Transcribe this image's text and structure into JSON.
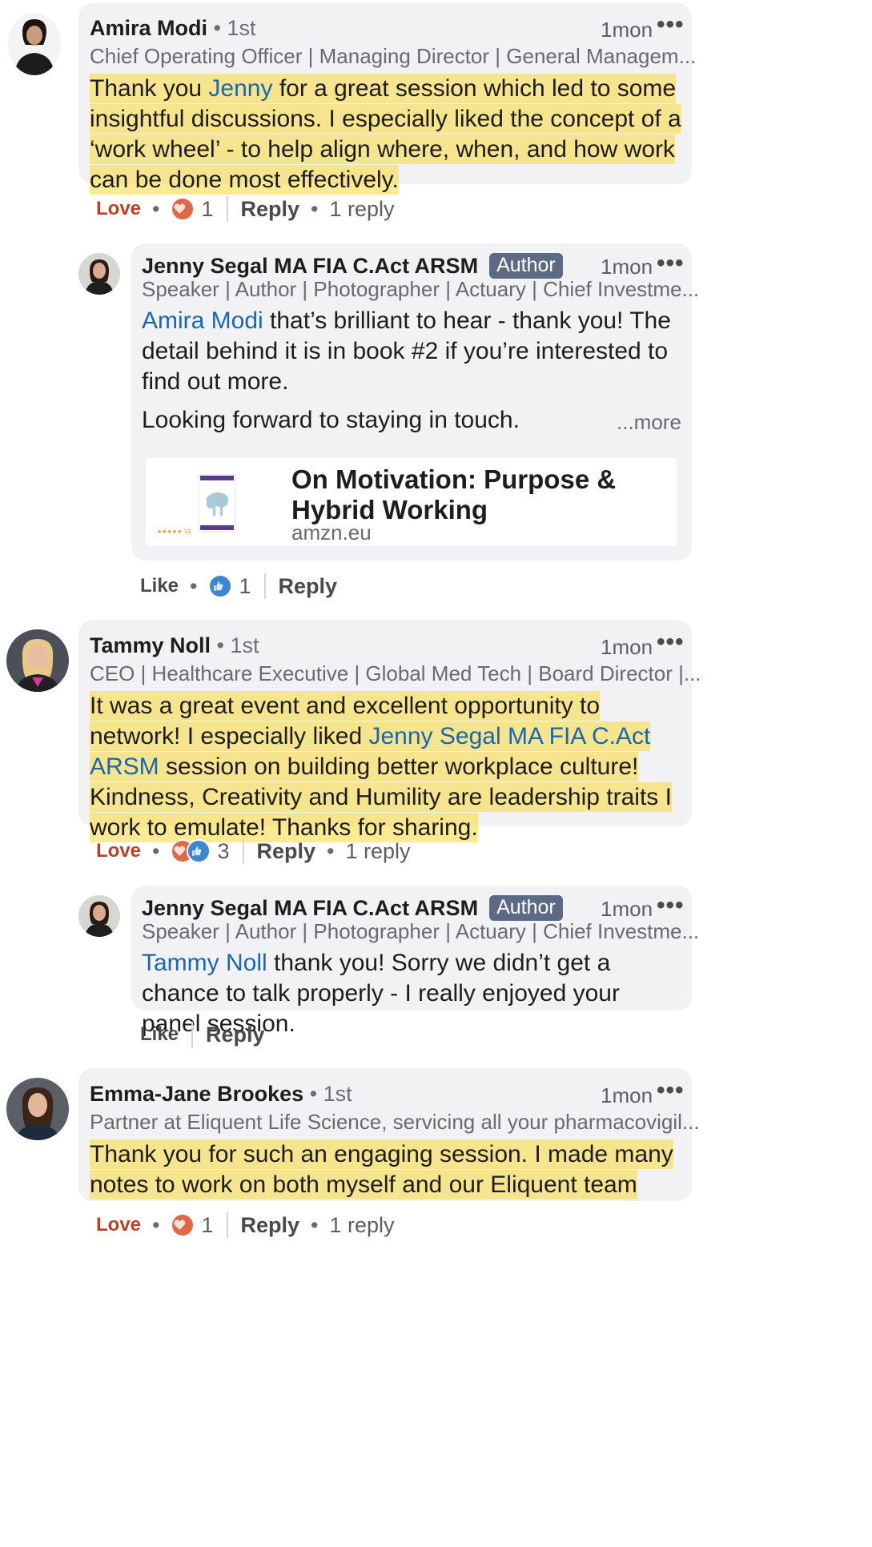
{
  "comments": [
    {
      "name": "Amira Modi",
      "degree": "• 1st",
      "time": "1mon",
      "headline": "Chief Operating Officer | Managing Director | General Managem...",
      "body_pre": "Thank you ",
      "mention": "Jenny",
      "body_post": " for a great session which led to some insightful discussions. I especially liked the concept of a ‘work wheel’ - to help align where, when, and how work can be done most effectively.",
      "reaction_label": "Love",
      "reaction_count": "1",
      "reply_label": "Reply",
      "replies_count": "1 reply"
    },
    {
      "name": "Tammy Noll",
      "degree": "• 1st",
      "time": "1mon",
      "headline": "CEO | Healthcare Executive | Global Med Tech | Board Director |...",
      "body_pre": "It was a great event and excellent opportunity to network! I especially liked ",
      "mention": "Jenny Segal MA FIA C.Act ARSM",
      "body_post": " session on building better workplace culture! Kindness, Creativity and Humility are leadership traits I work to emulate! Thanks for sharing.",
      "reaction_label": "Love",
      "reaction_count": "3",
      "reply_label": "Reply",
      "replies_count": "1 reply"
    },
    {
      "name": "Emma-Jane Brookes",
      "degree": "• 1st",
      "time": "1mon",
      "headline": "Partner at Eliquent Life Science, servicing all your pharmacovigil...",
      "body_pre": "Thank you for such an engaging session. I made many notes to work on both myself and our Eliquent team",
      "mention": "",
      "body_post": "",
      "reaction_label": "Love",
      "reaction_count": "1",
      "reply_label": "Reply",
      "replies_count": "1 reply"
    }
  ],
  "replies": [
    {
      "name": "Jenny Segal MA FIA C.Act ARSM",
      "badge": "Author",
      "time": "1mon",
      "headline": "Speaker | Author | Photographer | Actuary | Chief Investme...",
      "mention": "Amira Modi",
      "body_post": " that’s brilliant to hear - thank you!  The detail behind it is in book #2 if you’re interested to find out more.",
      "body_extra": "Looking forward to staying in touch.",
      "more_label": "...more",
      "link_title": "On Motivation: Purpose & Hybrid Working",
      "link_domain": "amzn.eu",
      "reaction_label": "Like",
      "reaction_count": "1",
      "reply_label": "Reply"
    },
    {
      "name": "Jenny Segal MA FIA C.Act ARSM",
      "badge": "Author",
      "time": "1mon",
      "headline": "Speaker | Author | Photographer | Actuary | Chief Investme...",
      "mention": "Tammy Noll",
      "body_post": " thank you!  Sorry we didn’t get a chance to talk properly - I really enjoyed your panel session.",
      "reaction_label": "Like",
      "reply_label": "Reply"
    }
  ],
  "icons": {
    "love": "heart-reaction",
    "like": "thumbs-up-reaction",
    "more": "more-options"
  },
  "colors": {
    "mention": "#1a66b0",
    "highlight": "#fcd83a",
    "love": "#b5432a",
    "author_badge": "#5c6a85"
  }
}
